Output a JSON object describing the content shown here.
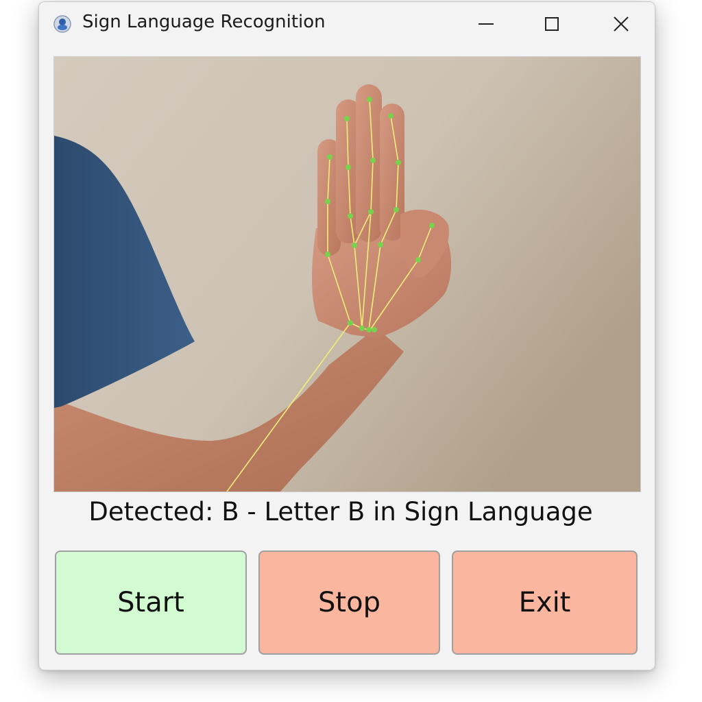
{
  "window": {
    "title": "Sign Language Recognition"
  },
  "status": {
    "text": "Detected: B - Letter B in Sign Language"
  },
  "buttons": {
    "start": {
      "label": "Start",
      "color": "#d2fbd2"
    },
    "stop": {
      "label": "Stop",
      "color": "#fbb6a0"
    },
    "exit": {
      "label": "Exit",
      "color": "#fbb6a0"
    }
  },
  "icons": {
    "app": "app-icon",
    "minimize": "minimize-icon",
    "maximize": "maximize-icon",
    "close": "close-icon"
  },
  "colors": {
    "landmark": "#77d24c",
    "connection": "#f2ee7a"
  }
}
